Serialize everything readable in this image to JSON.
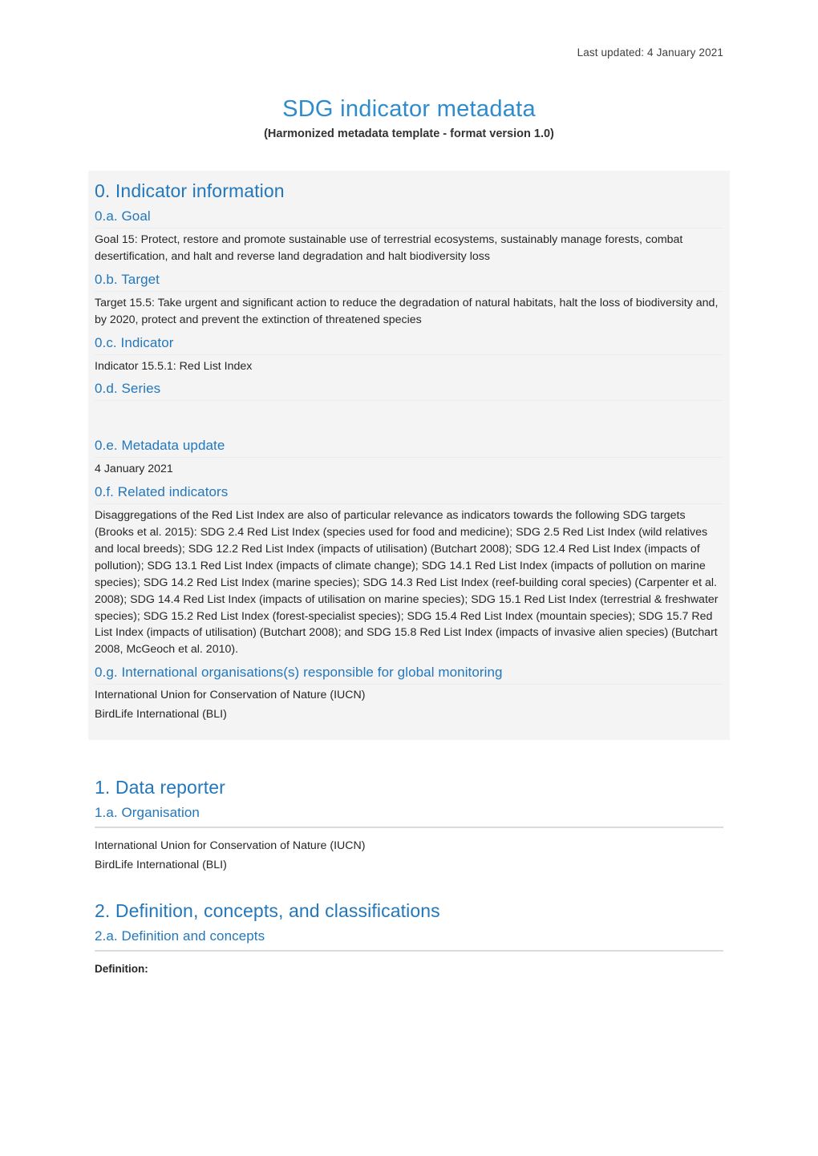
{
  "header": {
    "last_updated": "Last updated: 4 January 2021"
  },
  "title": {
    "main": "SDG indicator metadata",
    "subtitle": "(Harmonized metadata template - format version 1.0)"
  },
  "colors": {
    "title_blue": "#2E8BCC",
    "heading_blue": "#2377BB",
    "body_text": "#262626",
    "shaded_background": "#f4f4f4",
    "rule_grey": "#dcdcdc"
  },
  "sections": [
    {
      "id": "section-0",
      "heading": "0. Indicator information",
      "shaded": true,
      "items": [
        {
          "id": "0a",
          "heading": "0.a. Goal",
          "body": "Goal 15: Protect, restore and promote sustainable use of terrestrial ecosystems, sustainably manage forests, combat desertification, and halt and reverse land degradation and halt biodiversity loss"
        },
        {
          "id": "0b",
          "heading": "0.b. Target",
          "body": "Target 15.5: Take urgent and significant action to reduce the degradation of natural habitats, halt the loss of biodiversity and, by 2020, protect and prevent the extinction of threatened species"
        },
        {
          "id": "0c",
          "heading": "0.c. Indicator",
          "body": "Indicator 15.5.1:  Red List Index"
        },
        {
          "id": "0d",
          "heading": "0.d. Series",
          "body": ""
        },
        {
          "id": "0e",
          "heading": "0.e. Metadata update",
          "body": "4 January 2021"
        },
        {
          "id": "0f",
          "heading": "0.f. Related indicators",
          "body": "Disaggregations of the Red List Index are also of particular relevance as indicators towards the following SDG targets (Brooks et al. 2015): SDG 2.4 Red List Index (species used for food and medicine); SDG 2.5 Red List Index (wild relatives and local breeds); SDG 12.2 Red List Index (impacts of utilisation) (Butchart 2008); SDG 12.4 Red List Index (impacts of pollution); SDG 13.1 Red List Index (impacts of climate change); SDG 14.1 Red List Index (impacts of pollution on marine species); SDG 14.2 Red List Index (marine species); SDG 14.3 Red List Index (reef-building coral species) (Carpenter et al. 2008); SDG 14.4 Red List Index (impacts of utilisation on marine species); SDG 15.1 Red List Index (terrestrial & freshwater species); SDG 15.2 Red List Index (forest-specialist species); SDG 15.4 Red List Index (mountain species); SDG 15.7 Red List Index (impacts of utilisation) (Butchart 2008); and SDG 15.8 Red List Index (impacts of invasive alien species) (Butchart 2008, McGeoch et al. 2010)."
        },
        {
          "id": "0g",
          "heading": "0.g. International organisations(s) responsible for global monitoring",
          "body_line_1": "International Union for Conservation of Nature (IUCN)",
          "body_line_2": "BirdLife International (BLI)"
        }
      ]
    },
    {
      "id": "section-1",
      "heading": "1. Data reporter",
      "shaded": false,
      "items": [
        {
          "id": "1a",
          "heading": "1.a. Organisation",
          "body_line_1": "International Union for Conservation of Nature (IUCN)",
          "body_line_2": "BirdLife International (BLI)"
        }
      ]
    },
    {
      "id": "section-2",
      "heading": "2. Definition, concepts, and classifications",
      "shaded": false,
      "items": [
        {
          "id": "2a",
          "heading": "2.a. Definition and concepts",
          "body": "Definition:"
        }
      ]
    }
  ]
}
